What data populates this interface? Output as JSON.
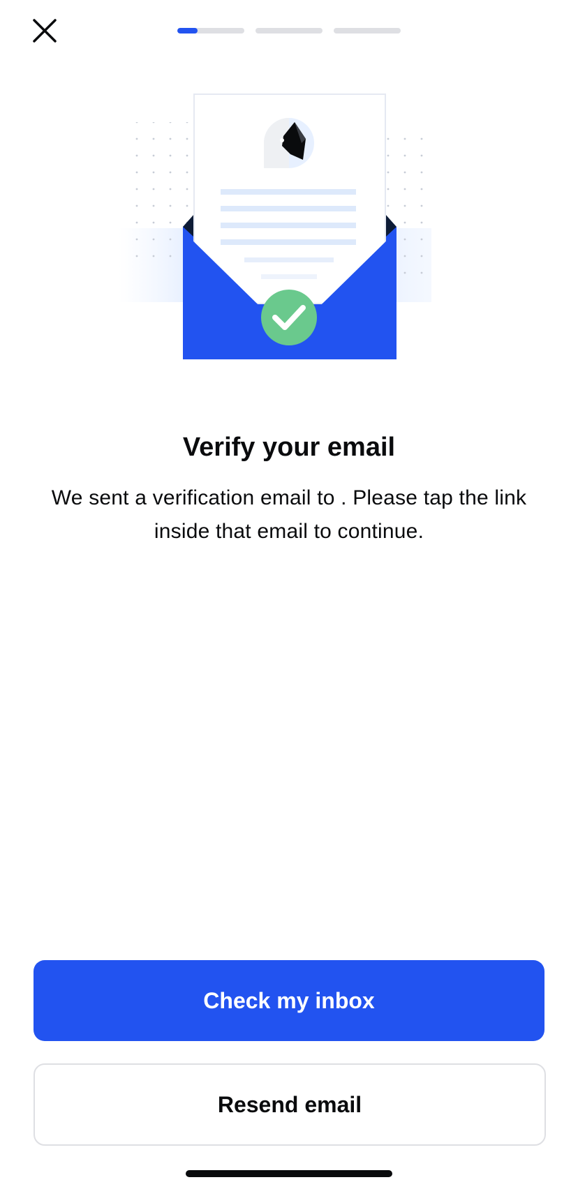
{
  "header": {
    "close_icon": "close-icon",
    "progress": {
      "total_steps": 3,
      "current_step": 1,
      "current_step_fill": 0.3
    }
  },
  "illustration": {
    "name": "email-verified-illustration",
    "icons": [
      "envelope-icon",
      "letter-icon",
      "checkmark-icon"
    ]
  },
  "content": {
    "title": "Verify your email",
    "body": "We sent a verification email to . Please tap the link inside that email to continue."
  },
  "actions": {
    "primary_label": "Check my inbox",
    "secondary_label": "Resend email"
  },
  "colors": {
    "accent": "#2253f0",
    "success": "#6ac98d",
    "track": "#dedfe3",
    "text": "#0a0b0d"
  }
}
